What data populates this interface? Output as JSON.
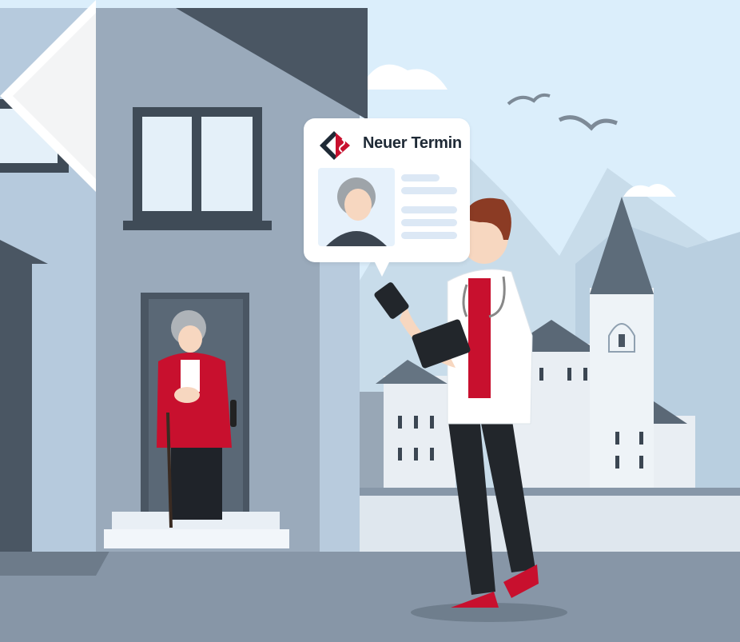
{
  "bubble": {
    "title": "Neuer Termin"
  },
  "colors": {
    "sky": "#dbeefb",
    "house": "#9aa8b7",
    "house_dark": "#4a5663",
    "accent_red": "#c8102e",
    "coat": "#ffffff",
    "ground": "#8797a8"
  },
  "icons": {
    "logo": "practice-logo-icon",
    "nav": "next-arrow-icon"
  }
}
